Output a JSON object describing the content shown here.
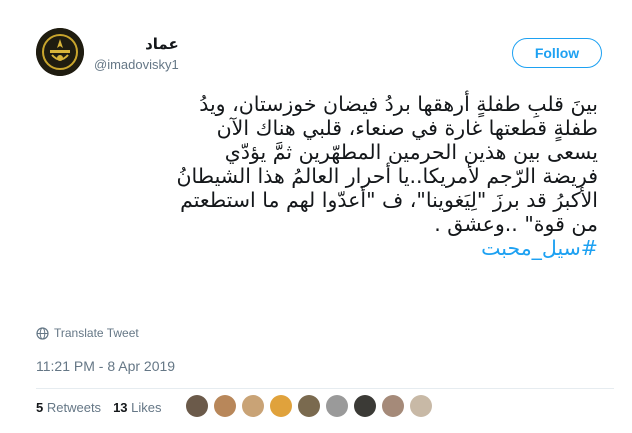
{
  "user": {
    "display_name": "عماد",
    "handle": "@imadovisky1"
  },
  "follow_label": "Follow",
  "tweet": {
    "lines": [
      "بينَ قلبِ طفلةٍ أرهقها بردُ  فيضان خوزستان، ويدُ",
      "طفلةٍ قطعتها غارة في صنعاء، قلبي هناك الآن",
      "يسعى بين هذين الحرمين المطهّرين ثمَّ يؤدّي",
      "فريضة الرّجم لأمريكا..يا أحرار العالمُ هذا الشيطانُ",
      "الأكبرُ قد برزَ \"لِيَغوينا\"، ف \"أعدّوا لهم ما استطعتم",
      "من قوة\" ..وعشق ."
    ],
    "hashtag": "#سیل_محبت"
  },
  "translate_label": "Translate Tweet",
  "timestamp": "11:21 PM - 8 Apr 2019",
  "stats": {
    "retweets_count": "5",
    "retweets_label": "Retweets",
    "likes_count": "13",
    "likes_label": "Likes"
  },
  "colors": {
    "accent": "#1da1f2",
    "secondary_text": "#657786",
    "divider": "#e6ecf0"
  },
  "likers": [
    {
      "icon": "liker-avatar",
      "color": "#6b5a4a"
    },
    {
      "icon": "liker-avatar",
      "color": "#b8875a"
    },
    {
      "icon": "liker-avatar",
      "color": "#c9a376"
    },
    {
      "icon": "liker-avatar",
      "color": "#e0a23c"
    },
    {
      "icon": "liker-avatar",
      "color": "#7a6a4f"
    },
    {
      "icon": "liker-avatar",
      "color": "#9a9a9a"
    },
    {
      "icon": "liker-avatar",
      "color": "#3b3a36"
    },
    {
      "icon": "liker-avatar",
      "color": "#a58a79"
    },
    {
      "icon": "liker-avatar",
      "color": "#c8b9a6"
    }
  ]
}
